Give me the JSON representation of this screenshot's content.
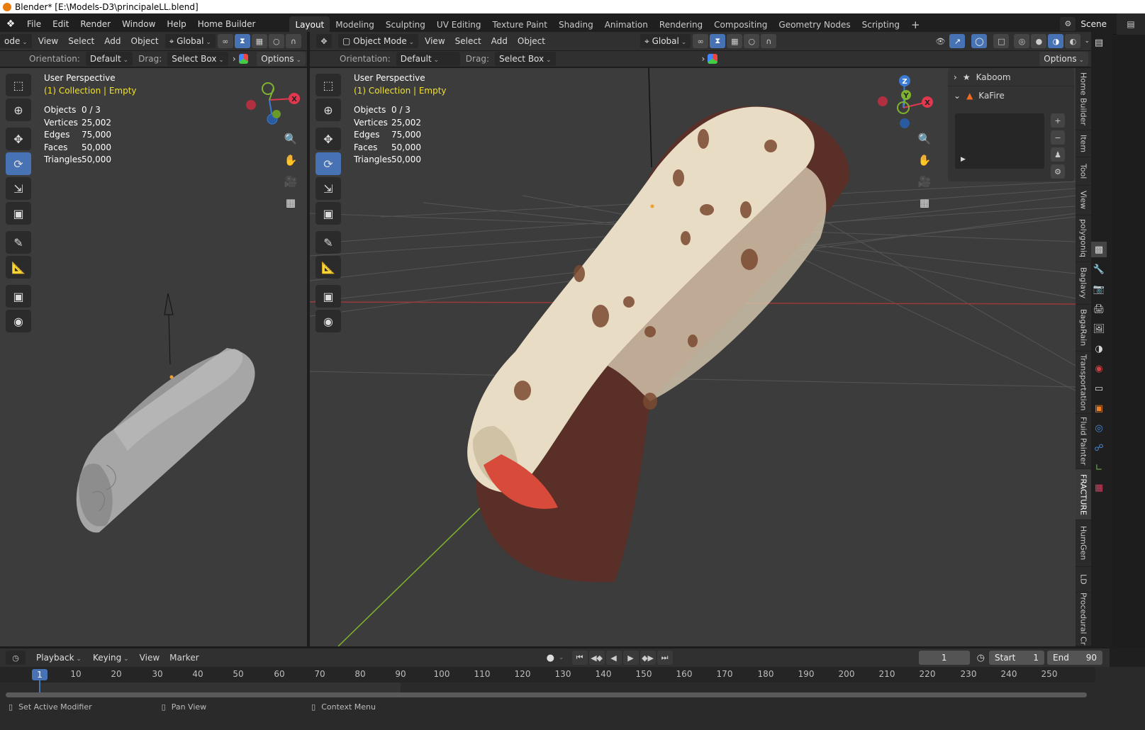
{
  "window_title": "Blender* [E:\\Models-D3\\principaleLL.blend]",
  "menu": [
    "File",
    "Edit",
    "Render",
    "Window",
    "Help",
    "Home Builder"
  ],
  "workspaces": [
    "Layout",
    "Modeling",
    "Sculpting",
    "UV Editing",
    "Texture Paint",
    "Shading",
    "Animation",
    "Rendering",
    "Compositing",
    "Geometry Nodes",
    "Scripting"
  ],
  "active_workspace": "Layout",
  "scene": "Scene",
  "left_view": {
    "mode": "ode",
    "menu": [
      "View",
      "Select",
      "Add",
      "Object"
    ],
    "transform": "Global",
    "orientation_label": "Orientation:",
    "orientation": "Default",
    "drag_label": "Drag:",
    "drag": "Select Box",
    "options": "Options",
    "perspective": "User Perspective",
    "collection": "(1) Collection | Empty",
    "stats": [
      {
        "k": "Objects",
        "v": "0 / 3"
      },
      {
        "k": "Vertices",
        "v": "25,002"
      },
      {
        "k": "Edges",
        "v": "75,000"
      },
      {
        "k": "Faces",
        "v": "50,000"
      },
      {
        "k": "Triangles",
        "v": "50,000"
      }
    ]
  },
  "right_view": {
    "mode": "Object Mode",
    "menu": [
      "View",
      "Select",
      "Add",
      "Object"
    ],
    "transform": "Global",
    "orientation_label": "Orientation:",
    "orientation": "Default",
    "drag_label": "Drag:",
    "drag": "Select Box",
    "options": "Options",
    "perspective": "User Perspective",
    "collection": "(1) Collection | Empty",
    "stats": [
      {
        "k": "Objects",
        "v": "0 / 3"
      },
      {
        "k": "Vertices",
        "v": "25,002"
      },
      {
        "k": "Edges",
        "v": "75,000"
      },
      {
        "k": "Faces",
        "v": "50,000"
      },
      {
        "k": "Triangles",
        "v": "50,000"
      }
    ]
  },
  "gizmo": {
    "x": "X",
    "y": "Y",
    "z": "Z"
  },
  "n_panel": {
    "items": [
      "Kaboom",
      "KaFire"
    ]
  },
  "side_tabs": [
    "Home Builder",
    "Item",
    "Tool",
    "View",
    "polygoniq",
    "Baglavy",
    "BagaRain",
    "Transportation",
    "Fluid Painter",
    "FRACTURE",
    "HumGen",
    "LD",
    "Procedural Cr"
  ],
  "timeline": {
    "menu": [
      "Playback",
      "Keying",
      "View",
      "Marker"
    ],
    "current_frame": "1",
    "start_label": "Start",
    "start": "1",
    "end_label": "End",
    "end": "90",
    "ruler_current": "1",
    "ticks": [
      "10",
      "20",
      "30",
      "40",
      "50",
      "60",
      "70",
      "80",
      "90",
      "100",
      "110",
      "120",
      "130",
      "140",
      "150",
      "160",
      "170",
      "180",
      "190",
      "200",
      "210",
      "220",
      "230",
      "240",
      "250"
    ]
  },
  "status": {
    "items": [
      "Set Active Modifier",
      "Pan View",
      "Context Menu"
    ]
  },
  "colors": {
    "accent": "#4772b3",
    "x_axis": "#e2384f",
    "y_axis": "#7fb32e",
    "z_axis": "#3b7bd3",
    "collection_text": "#f0e030"
  }
}
